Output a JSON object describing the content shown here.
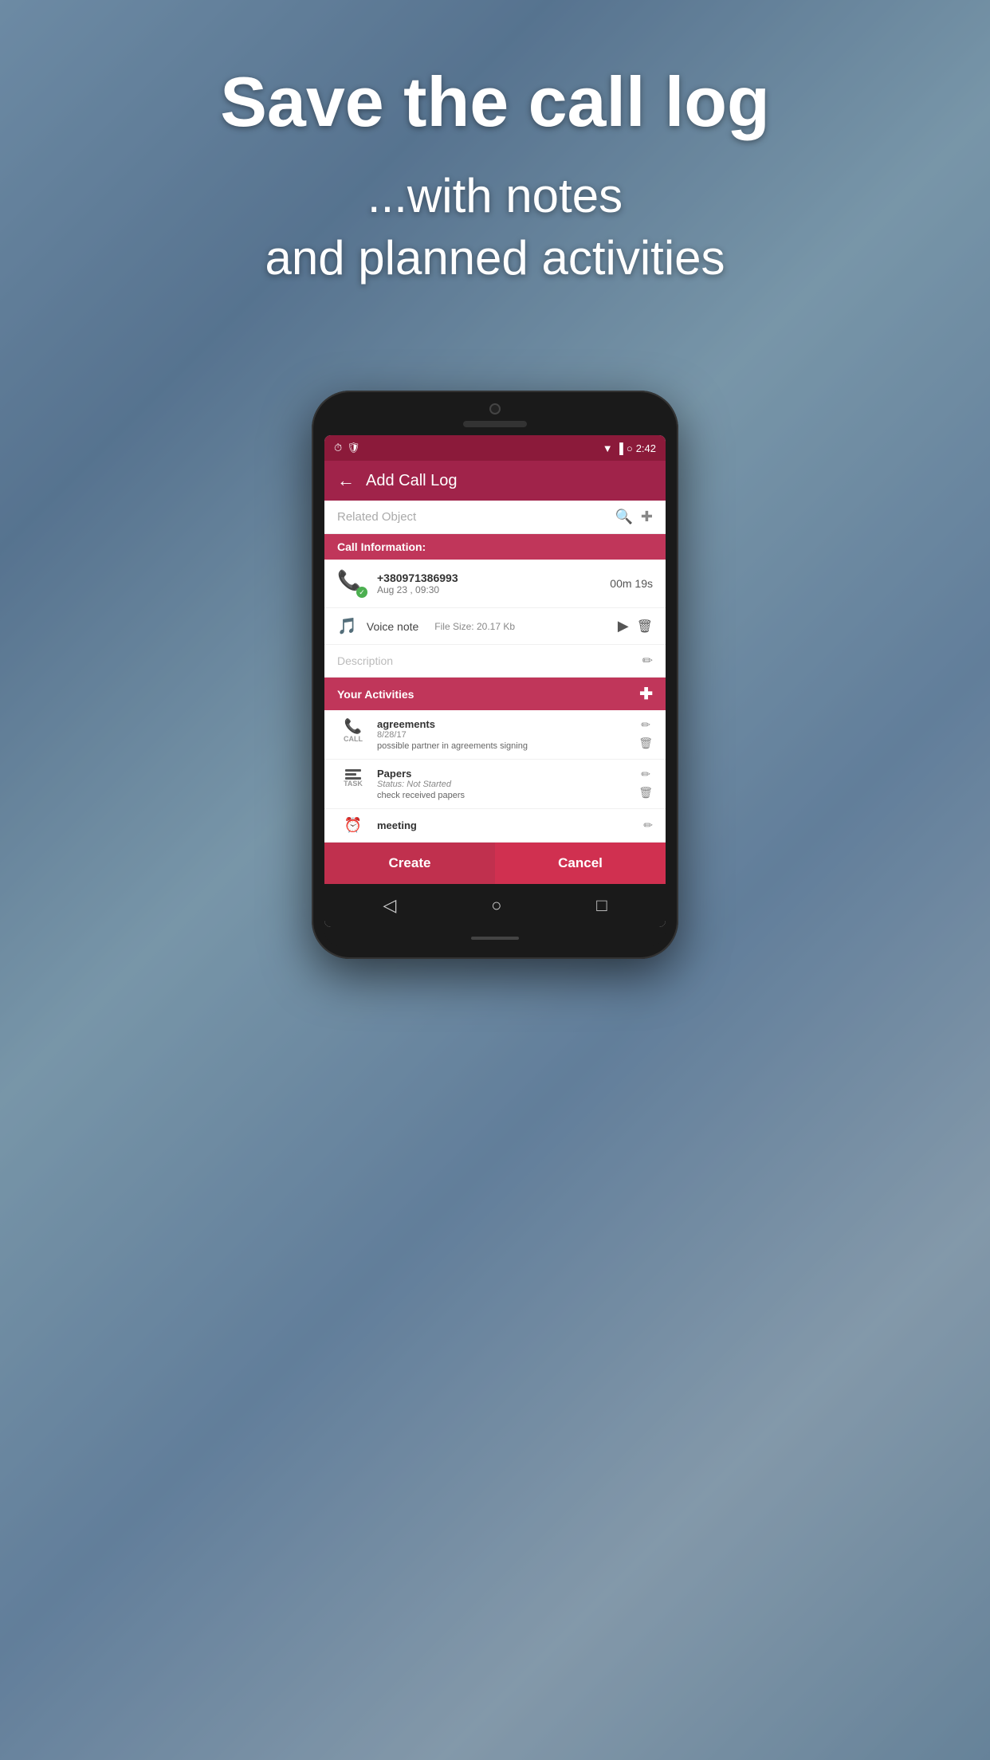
{
  "hero": {
    "title": "Save the call log",
    "subtitle_line1": "...with notes",
    "subtitle_line2": "and planned activities"
  },
  "status_bar": {
    "time": "2:42",
    "icons": [
      "clock-icon",
      "shield-icon",
      "wifi-icon",
      "signal-icon",
      "battery-icon"
    ]
  },
  "header": {
    "title": "Add Call Log",
    "back_label": "←"
  },
  "related_object": {
    "placeholder": "Related Object"
  },
  "call_information": {
    "section_label": "Call Information:",
    "phone_number": "+380971386993",
    "call_date": "Aug 23 , 09:30",
    "duration": "00m 19s",
    "voice_note_label": "Voice note",
    "file_size_label": "File Size: 20.17 Kb",
    "description_placeholder": "Description"
  },
  "your_activities": {
    "section_label": "Your Activities",
    "activities": [
      {
        "type": "CALL",
        "title": "agreements",
        "date": "8/28/17",
        "description": "possible partner in agreements signing"
      },
      {
        "type": "TASK",
        "title": "Papers",
        "status": "Status: Not Started",
        "description": "check received papers"
      },
      {
        "type": "MEETING",
        "title": "meeting"
      }
    ]
  },
  "buttons": {
    "create_label": "Create",
    "cancel_label": "Cancel"
  },
  "bottom_nav": {
    "back_icon": "◁",
    "home_icon": "○",
    "recent_icon": "□"
  }
}
